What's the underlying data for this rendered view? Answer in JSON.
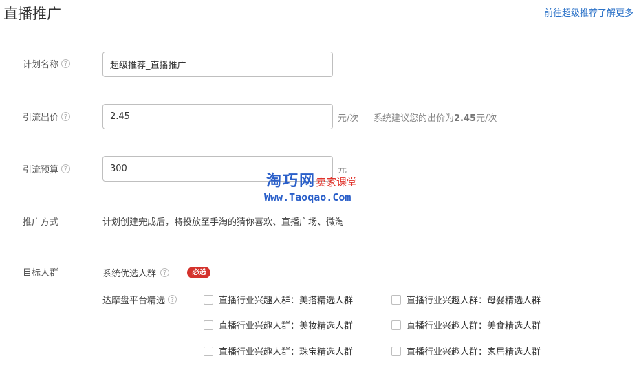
{
  "header": {
    "title": "直播推广",
    "learn_more": "前往超级推荐了解更多"
  },
  "form": {
    "plan_name": {
      "label": "计划名称",
      "value": "超级推荐_直播推广"
    },
    "bid": {
      "label": "引流出价",
      "value": "2.45",
      "unit": "元/次",
      "hint_prefix": "系统建议您的出价为",
      "hint_value": "2.45",
      "hint_unit": "元/次"
    },
    "budget": {
      "label": "引流预算",
      "value": "300",
      "unit": "元"
    },
    "promo_method": {
      "label": "推广方式",
      "text": "计划创建完成后，将投放至手淘的猜你喜欢、直播广场、微淘"
    },
    "target": {
      "label": "目标人群",
      "system_pick": {
        "label": "系统优选人群",
        "badge": "必选"
      },
      "damopan": {
        "label": "达摩盘平台精选",
        "options": [
          "直播行业兴趣人群：美搭精选人群",
          "直播行业兴趣人群：母婴精选人群",
          "直播行业兴趣人群：美妆精选人群",
          "直播行业兴趣人群：美食精选人群",
          "直播行业兴趣人群：珠宝精选人群",
          "直播行业兴趣人群：家居精选人群"
        ]
      }
    }
  },
  "help_glyph": "?",
  "watermark": {
    "line1": "淘巧网",
    "line1_suffix": "卖家课堂",
    "line2": "Www.Taoqao.Com"
  },
  "colors": {
    "link": "#2b72c8",
    "badge": "#d4322c",
    "watermark_blue": "#2a5fc9",
    "watermark_red": "#e0342c"
  }
}
